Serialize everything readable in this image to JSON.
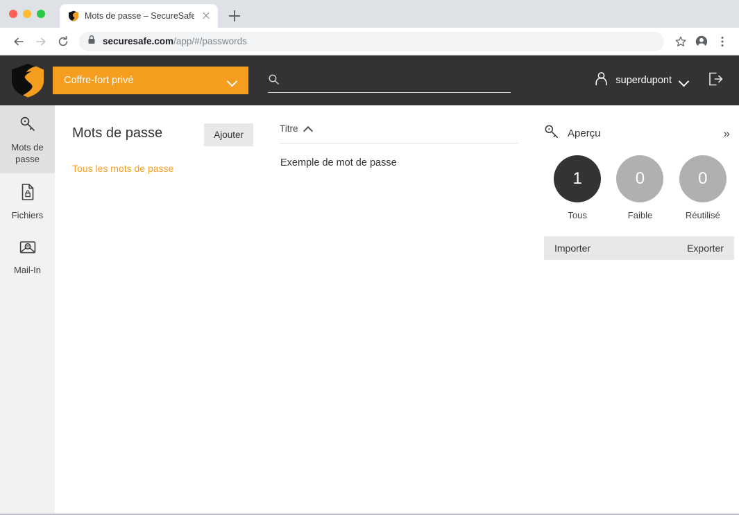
{
  "browser": {
    "tab": {
      "title": "Mots de passe – SecureSafe",
      "favicon": "securesafe-shield-icon",
      "close": "×"
    },
    "new_tab_label": "+",
    "nav": {
      "back": "←",
      "forward": "→",
      "reload": "⟳"
    },
    "omnibox": {
      "lock": "lock-icon",
      "url_domain": "securesafe.com",
      "url_path": "/app/#/passwords",
      "full_url": "securesafe.com/app/#/passwords"
    },
    "actions": {
      "bookmark": "star-icon",
      "profile": "profile-icon",
      "menu": "three-dot-menu-icon"
    },
    "traffic_lights": {
      "close": "#ff5f57",
      "minimize": "#febc2e",
      "maximize": "#28c840"
    }
  },
  "header": {
    "logo": "securesafe-logo",
    "vault": {
      "label": "Coffre-fort privé",
      "chevron": "chevron-down-icon"
    },
    "search": {
      "value": "",
      "placeholder": "",
      "icon": "search-icon"
    },
    "user": {
      "name": "superdupont",
      "icon": "user-icon",
      "chevron": "chevron-down-icon"
    },
    "logout": "logout-icon",
    "background": "#333333",
    "accent": "#f59d1f"
  },
  "sidebar": {
    "items": [
      {
        "label": "Mots de passe",
        "icon": "key-icon",
        "active": true
      },
      {
        "label": "Fichiers",
        "icon": "file-lock-icon",
        "active": false
      },
      {
        "label": "Mail-In",
        "icon": "envelope-icon",
        "active": false
      }
    ]
  },
  "left_panel": {
    "title": "Mots de passe",
    "add_button": "Ajouter",
    "all_passwords_link": "Tous les mots de passe"
  },
  "list_panel": {
    "column_header": "Titre",
    "sort_direction": "ascending",
    "sort_icon": "chevron-up-icon",
    "rows": [
      {
        "title": "Exemple de mot de passe"
      }
    ]
  },
  "right_panel": {
    "title": "Aperçu",
    "icon": "key-icon",
    "collapse_button": "»",
    "stats": [
      {
        "value": "1",
        "label": "Tous",
        "color": "#333333"
      },
      {
        "value": "0",
        "label": "Faible",
        "color": "#b0b0b0"
      },
      {
        "value": "0",
        "label": "Réutilisé",
        "color": "#b0b0b0"
      }
    ],
    "import_label": "Importer",
    "export_label": "Exporter"
  }
}
